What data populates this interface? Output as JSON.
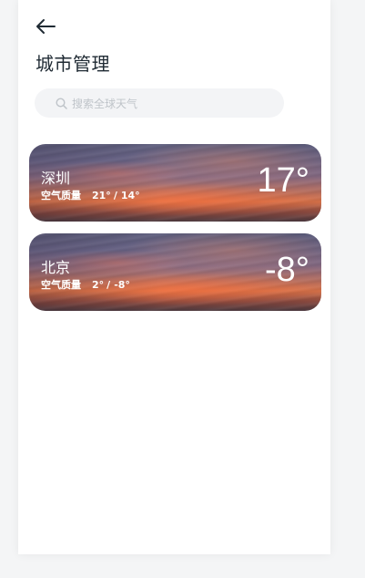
{
  "header": {
    "back_icon": "arrow-left-icon",
    "title": "城市管理"
  },
  "search": {
    "icon": "search-icon",
    "placeholder": "搜索全球天气"
  },
  "cities": [
    {
      "name": "深圳",
      "air_quality_label": "空气质量",
      "high": "21°",
      "separator": "/",
      "low": "14°",
      "temperature": "17°"
    },
    {
      "name": "北京",
      "air_quality_label": "空气质量",
      "high": "2°",
      "separator": "/",
      "low": "-8°",
      "temperature": "-8°"
    }
  ],
  "colors": {
    "title_text": "#1f2a33",
    "search_bg": "#f3f4f6",
    "placeholder_text": "#bfc4c9",
    "card_text": "#ffffff"
  }
}
